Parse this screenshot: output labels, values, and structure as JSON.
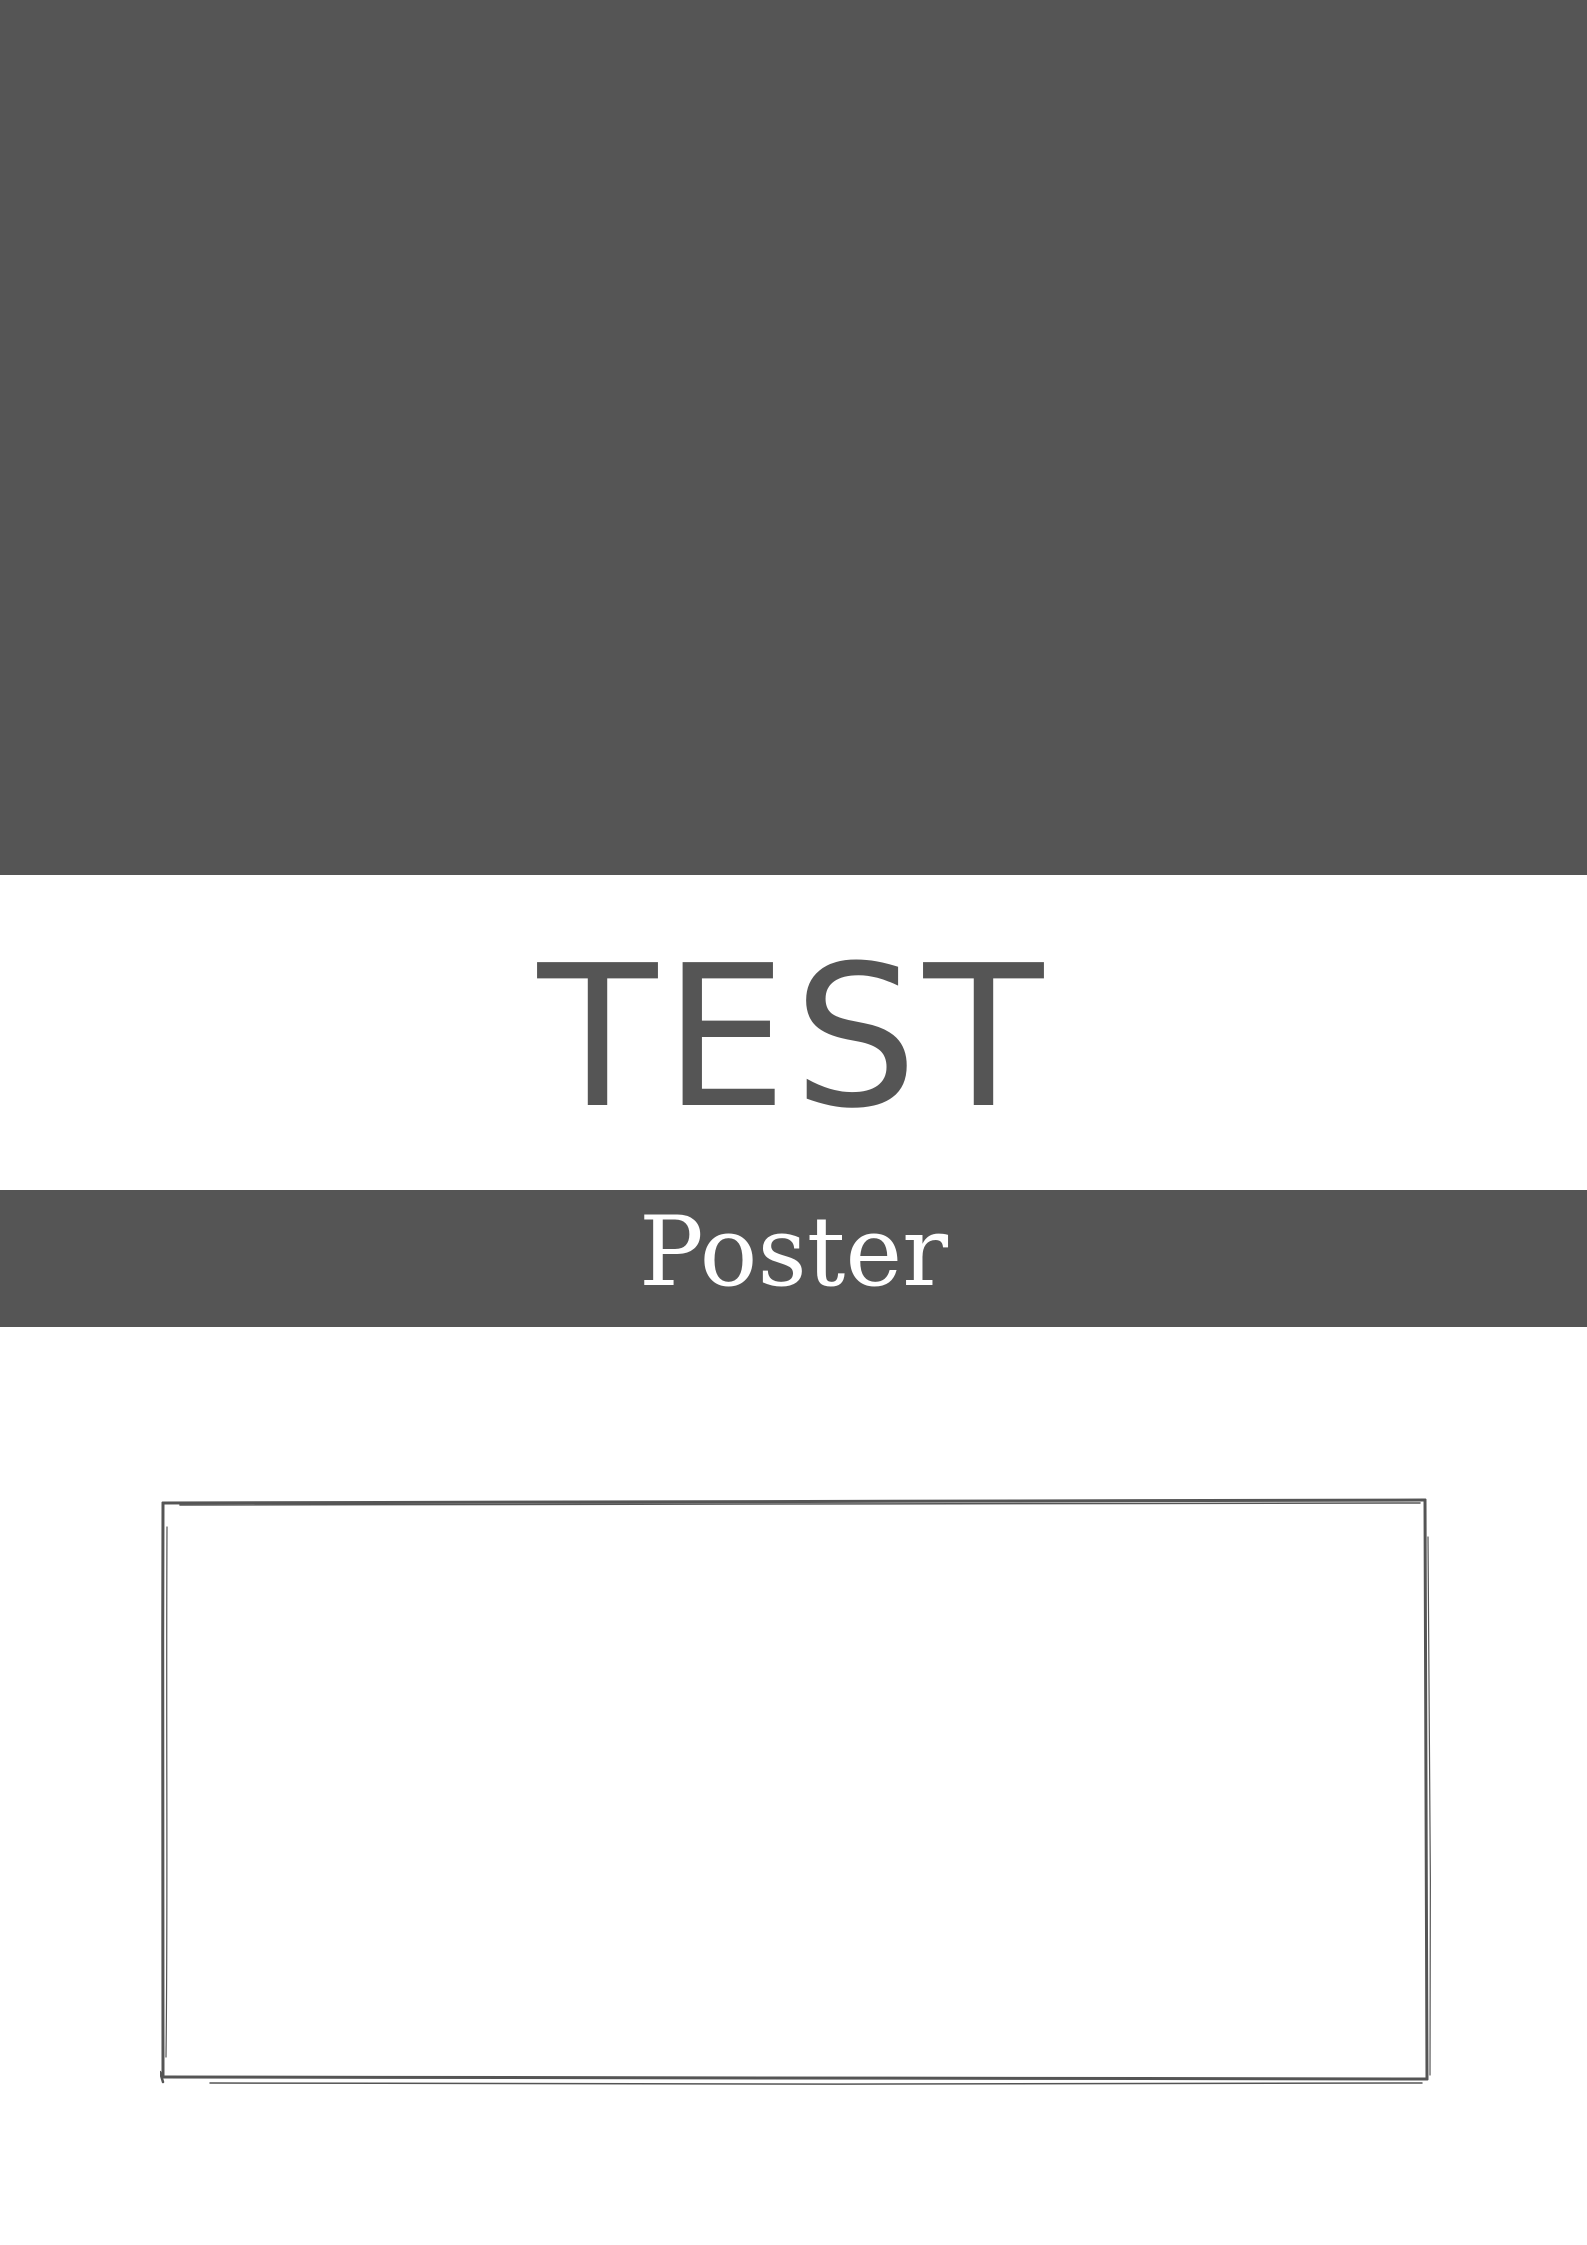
{
  "poster": {
    "title": "TEST",
    "subtitle": "Poster"
  },
  "colors": {
    "band": "#555555",
    "background": "#ffffff",
    "subtitle_text": "#ffffff",
    "frame_stroke": "#555555"
  }
}
